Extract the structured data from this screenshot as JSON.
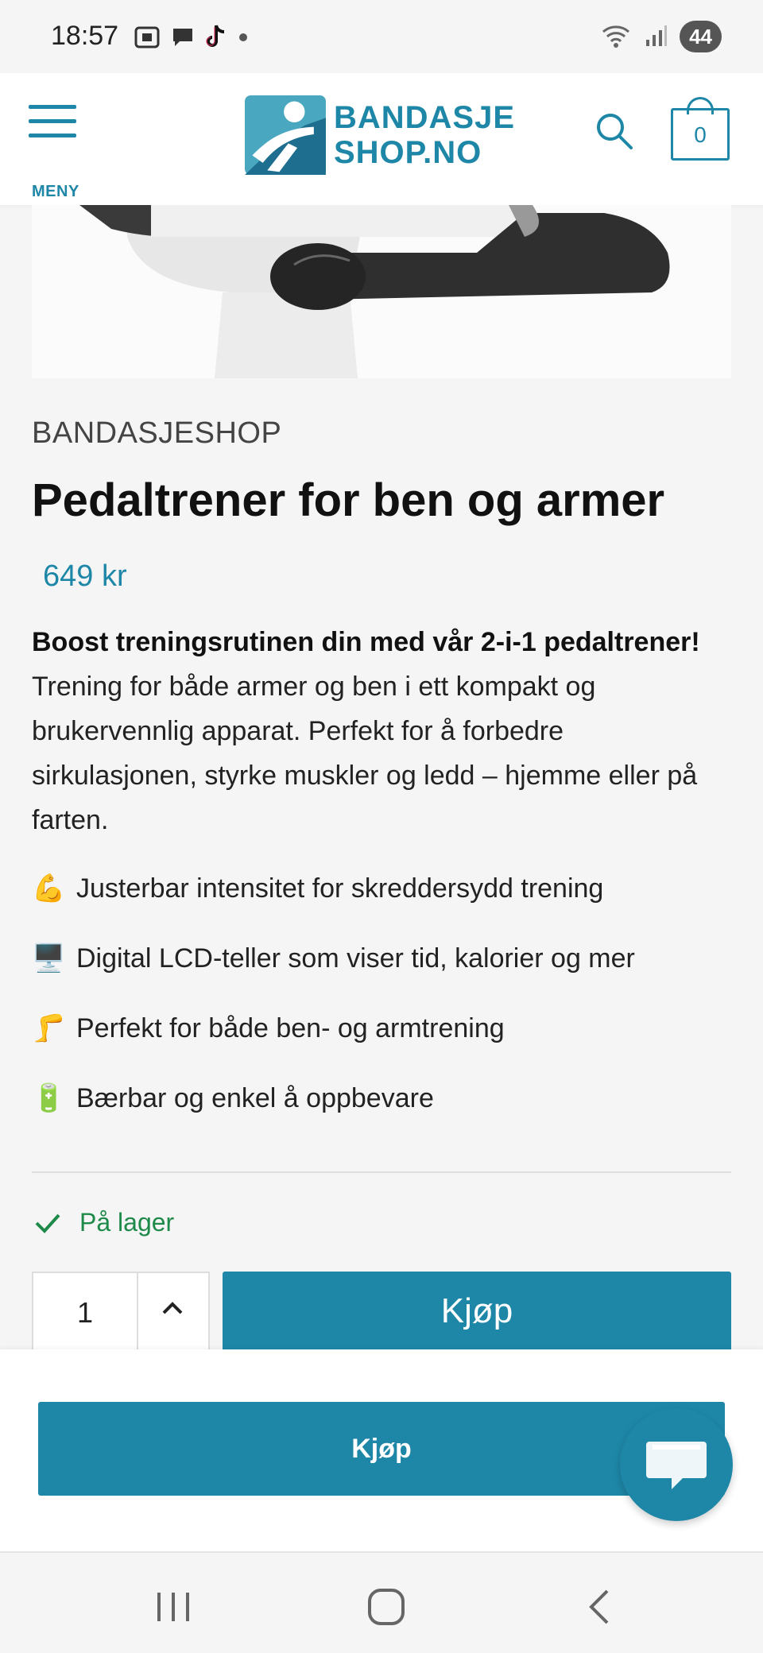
{
  "status_bar": {
    "time": "18:57",
    "battery": "44"
  },
  "header": {
    "menu_label": "MENY",
    "logo_line1": "BANDASJE",
    "logo_line2": "SHOP.NO",
    "cart_count": "0"
  },
  "product": {
    "brand": "BANDASJESHOP",
    "title": "Pedaltrener for ben og armer",
    "price": "649 kr",
    "desc_bold": "Boost treningsrutinen din med vår 2-i-1 pedaltrener!",
    "desc_text": " Trening for både armer og ben i ett kompakt og brukervennlig apparat. Perfekt for å forbedre sirkulasjonen, styrke muskler og ledd – hjemme eller på farten.",
    "features": [
      {
        "emoji": "💪",
        "text": "Justerbar intensitet for skreddersydd trening"
      },
      {
        "emoji": "🖥️",
        "text": "Digital LCD-teller som viser tid, kalorier og mer"
      },
      {
        "emoji": "🦵",
        "text": "Perfekt for både ben- og armtrening"
      },
      {
        "emoji": "🔋",
        "text": "Bærbar og enkel å oppbevare"
      }
    ],
    "stock": "På lager",
    "quantity": "1",
    "buy_label": "Kjøp"
  },
  "sticky": {
    "buy_label": "Kjøp"
  },
  "colors": {
    "accent": "#1e87a8",
    "stock_green": "#1e8a4a"
  }
}
